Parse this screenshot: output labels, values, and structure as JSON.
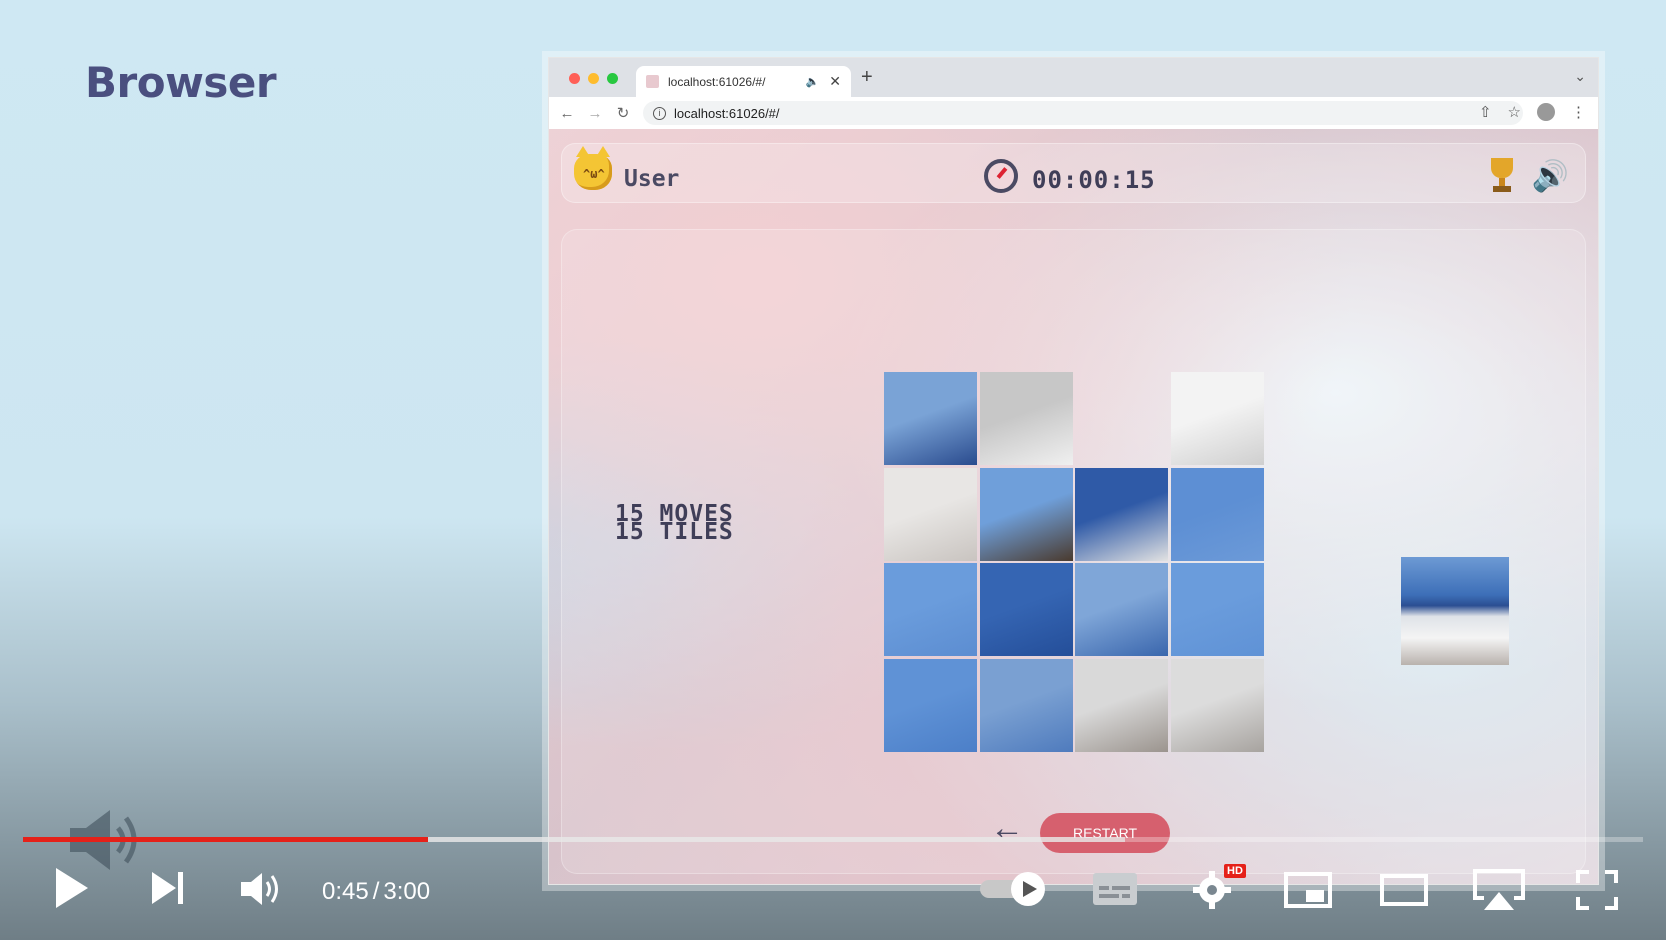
{
  "slide": {
    "title": "Browser"
  },
  "browser": {
    "tab_title": "localhost:61026/#/",
    "url": "localhost:61026/#/"
  },
  "game": {
    "user_label": "User",
    "timer": "00:00:15",
    "moves_text": "15 MOVES",
    "tiles_text": "15 TILES",
    "restart_label": "RESTART",
    "tiles": [
      {
        "row": 0,
        "col": 0,
        "top": "#7aa3d6",
        "bottom": "#2a4b8e"
      },
      {
        "row": 0,
        "col": 1,
        "top": "#c7c7c7",
        "bottom": "#f0f0f0"
      },
      {
        "row": 0,
        "col": 2,
        "empty": true
      },
      {
        "row": 0,
        "col": 3,
        "top": "#f3f3f3",
        "bottom": "#cfcfcf"
      },
      {
        "row": 1,
        "col": 0,
        "top": "#e8e6e4",
        "bottom": "#c9c4c0"
      },
      {
        "row": 1,
        "col": 1,
        "top": "#6f9fda",
        "bottom": "#4a3a2e"
      },
      {
        "row": 1,
        "col": 2,
        "top": "#2f5aa7",
        "bottom": "#e2e2e2"
      },
      {
        "row": 1,
        "col": 3,
        "top": "#5d8fd4",
        "bottom": "#6c9ad8"
      },
      {
        "row": 2,
        "col": 0,
        "top": "#6a9cdc",
        "bottom": "#5c8dd1"
      },
      {
        "row": 2,
        "col": 1,
        "top": "#3565b3",
        "bottom": "#244e99"
      },
      {
        "row": 2,
        "col": 2,
        "top": "#7fa6d8",
        "bottom": "#3a66ad"
      },
      {
        "row": 2,
        "col": 3,
        "top": "#6a9cdc",
        "bottom": "#5f92d6"
      },
      {
        "row": 3,
        "col": 0,
        "top": "#5f92d6",
        "bottom": "#4c7fc8"
      },
      {
        "row": 3,
        "col": 1,
        "top": "#7aa0d2",
        "bottom": "#4f7bbd"
      },
      {
        "row": 3,
        "col": 2,
        "top": "#d9d9d9",
        "bottom": "#9b948e"
      },
      {
        "row": 3,
        "col": 3,
        "top": "#dcdcdc",
        "bottom": "#a7a39f"
      }
    ]
  },
  "player": {
    "current_time": "0:45",
    "separator": "/",
    "duration": "3:00",
    "played_fraction": 0.25,
    "buffered_fraction": 0.68,
    "hd_badge": "HD",
    "accent_color": "#e52119"
  }
}
